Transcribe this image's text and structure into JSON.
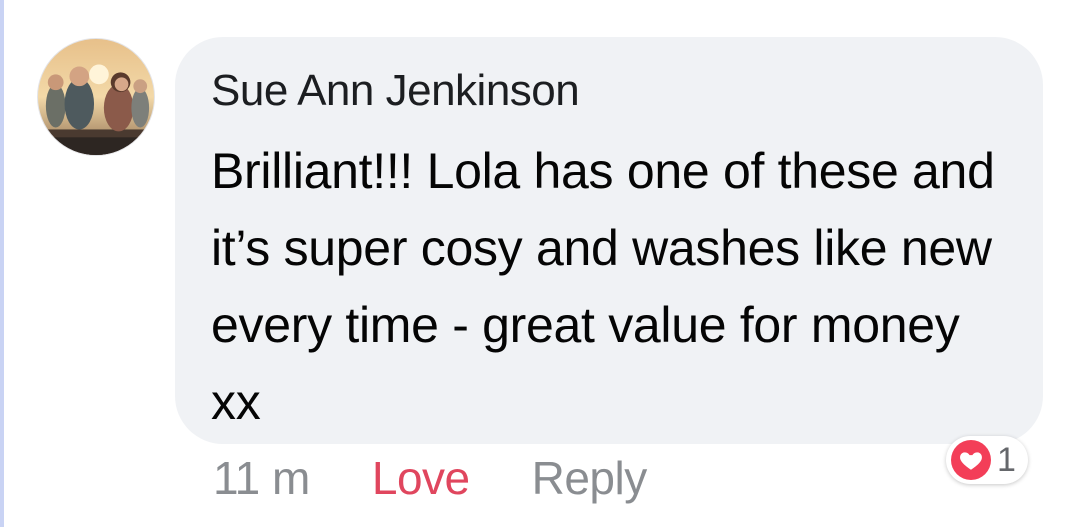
{
  "comment": {
    "author": "Sue Ann Jenkinson",
    "text": "Brilliant!!! Lola has one of these and it’s super cosy and washes like new every time - great value for money xx",
    "timestamp": "11 m",
    "love_label": "Love",
    "reply_label": "Reply",
    "reaction": {
      "icon": "heart-icon",
      "count": "1",
      "color": "#f33e58"
    }
  },
  "colors": {
    "bubble_bg": "#f0f2f5",
    "love_active": "#e0465e",
    "muted": "#8a8d91",
    "thread_line": "#c9d3f4"
  }
}
